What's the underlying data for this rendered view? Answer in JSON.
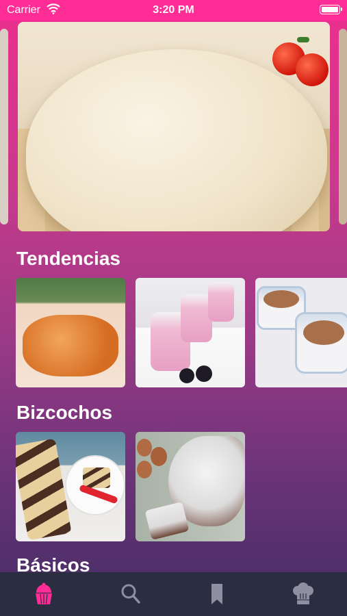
{
  "status_bar": {
    "carrier": "Carrier",
    "time": "3:20 PM"
  },
  "featured": {
    "image_name": "bread-dough"
  },
  "sections": [
    {
      "title": "Tendencias",
      "items": [
        "fried-dough-balls",
        "berry-yogurt-cups",
        "cookie-custard-cups"
      ]
    },
    {
      "title": "Bizcochos",
      "items": [
        "marble-loaf-cake",
        "chocolate-sponge-cake"
      ]
    },
    {
      "title": "Básicos",
      "items": []
    }
  ],
  "tab_bar": {
    "active_color": "#ff2d95",
    "inactive_color": "#8e8fa0",
    "tabs": [
      {
        "icon": "cupcake-icon",
        "active": true
      },
      {
        "icon": "search-icon",
        "active": false
      },
      {
        "icon": "bookmark-icon",
        "active": false
      },
      {
        "icon": "chef-hat-icon",
        "active": false
      }
    ]
  }
}
